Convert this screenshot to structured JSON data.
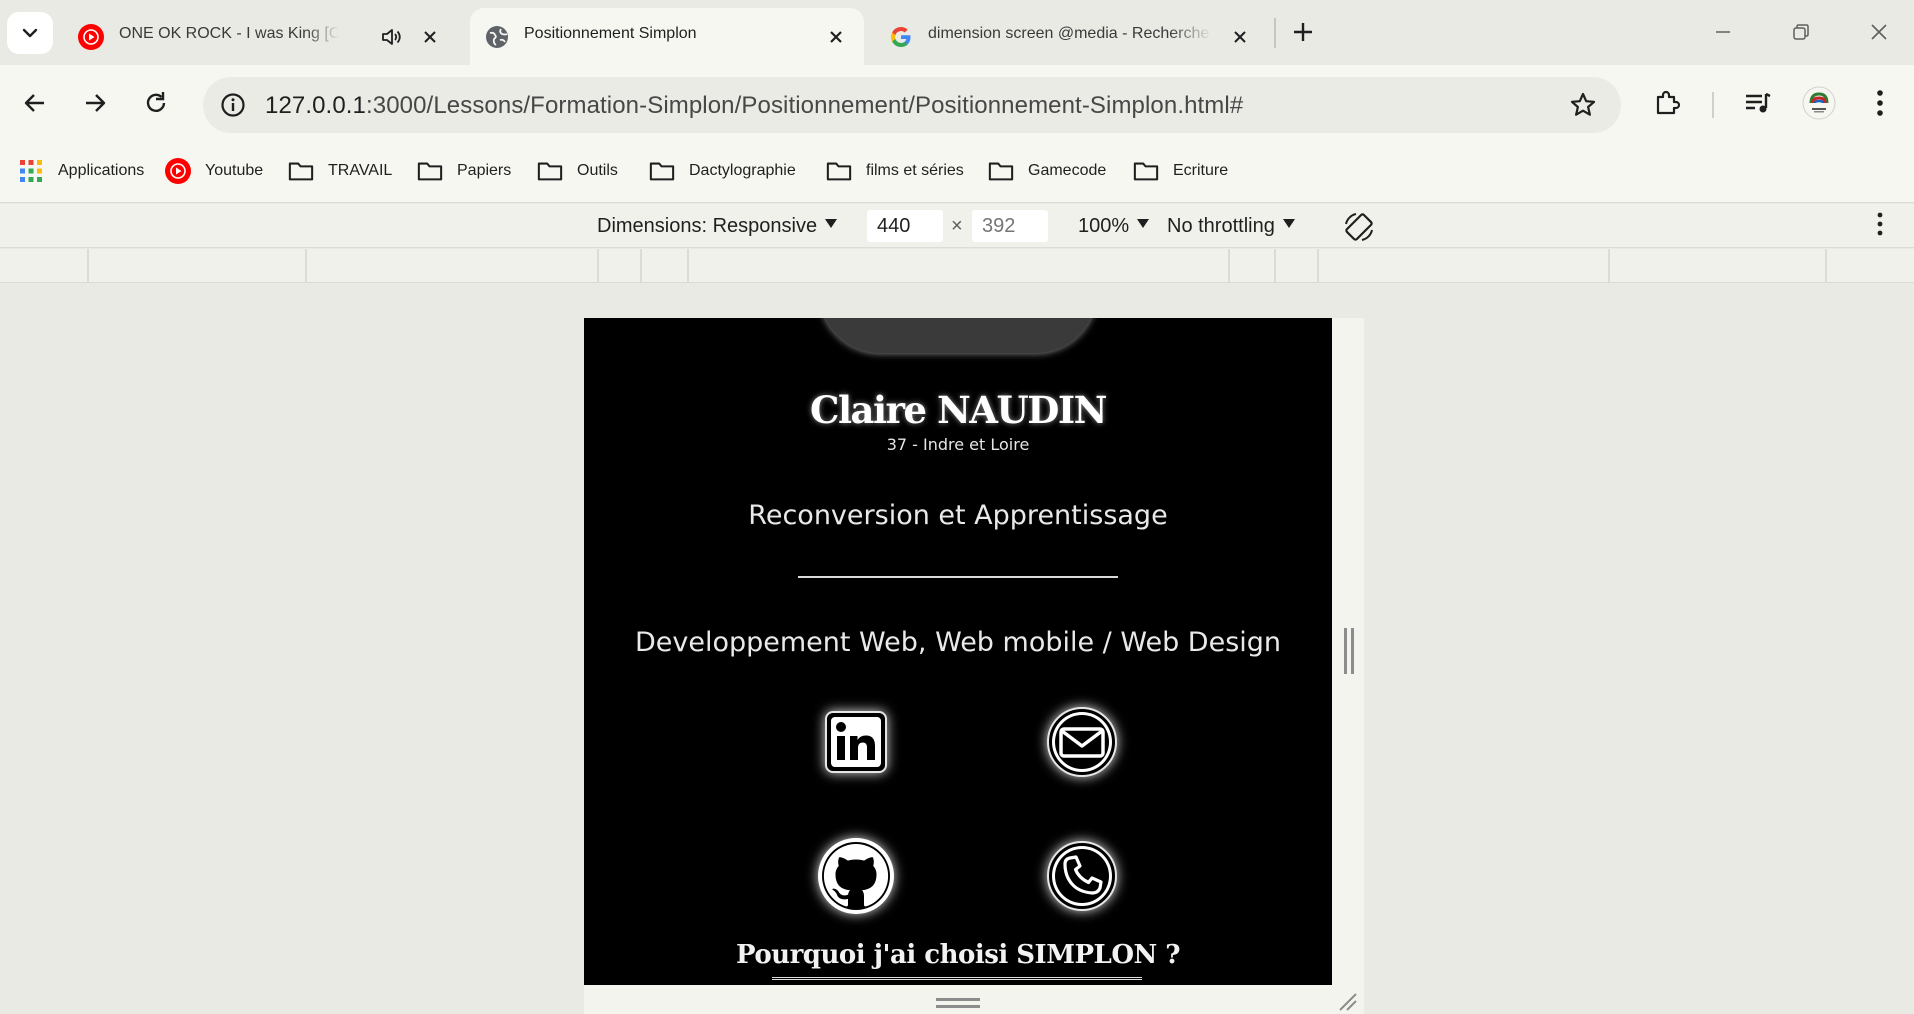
{
  "tabs": [
    {
      "title": "ONE OK ROCK - I was King [Official V",
      "favicon": "youtube-music-icon",
      "audio": true
    },
    {
      "title": "Positionnement Simplon",
      "favicon": "globe-icon",
      "active": true
    },
    {
      "title": "dimension screen @media - Recherche Go",
      "favicon": "google-icon"
    }
  ],
  "address_bar": {
    "host": "127.0.0.1",
    "path": ":3000/Lessons/Formation-Simplon/Positionnement/Positionnement-Simplon.html#"
  },
  "bookmarks": [
    {
      "label": "Applications",
      "icon": "apps-grid-icon"
    },
    {
      "label": "Youtube",
      "icon": "youtube-music-icon"
    },
    {
      "label": "TRAVAIL",
      "icon": "folder-icon"
    },
    {
      "label": "Papiers",
      "icon": "folder-icon"
    },
    {
      "label": "Outils",
      "icon": "folder-icon"
    },
    {
      "label": "Dactylographie",
      "icon": "folder-icon"
    },
    {
      "label": "films et séries",
      "icon": "folder-icon"
    },
    {
      "label": "Gamecode",
      "icon": "folder-icon"
    },
    {
      "label": "Ecriture",
      "icon": "folder-icon"
    }
  ],
  "device_toolbar": {
    "dimensions_label": "Dimensions: Responsive",
    "width": "440",
    "height_placeholder": "392",
    "times": "×",
    "zoom": "100%",
    "throttling": "No throttling"
  },
  "page": {
    "name": "Claire NAUDIN",
    "location": "37 - Indre et Loire",
    "subtitle1": "Reconversion et Apprentissage",
    "subtitle2": "Developpement Web, Web mobile / Web Design",
    "contact_icons": [
      "linkedin-icon",
      "mail-icon",
      "github-icon",
      "phone-icon"
    ],
    "why_heading": "Pourquoi j'ai choisi SIMPLON ?"
  },
  "colors": {
    "youtube_red": "#ff0000",
    "chrome_bg": "#e9eae4",
    "toolbar_bg": "#f7f7f2",
    "page_bg": "#000000"
  }
}
